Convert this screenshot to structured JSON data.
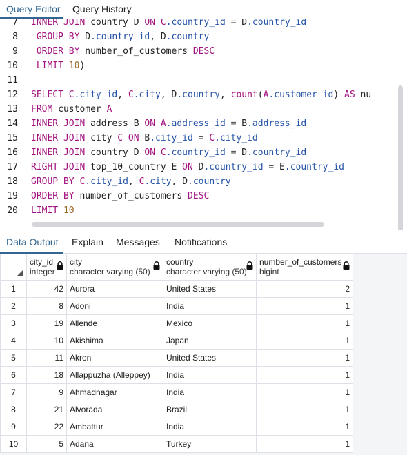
{
  "top_tabs": [
    {
      "label": "Query Editor",
      "active": true
    },
    {
      "label": "Query History",
      "active": false
    }
  ],
  "editor": {
    "line_numbers": [
      "7",
      "8",
      "9",
      "10",
      "11",
      "12",
      "13",
      "14",
      "15",
      "16",
      "17",
      "18",
      "19",
      "20"
    ],
    "lines": [
      [
        {
          "t": "INNER JOIN ",
          "c": "kw"
        },
        {
          "t": "country ",
          "c": "plain"
        },
        {
          "t": "D ",
          "c": "plain"
        },
        {
          "t": "ON ",
          "c": "kw"
        },
        {
          "t": "C",
          "c": "alias"
        },
        {
          "t": ".country_id",
          "c": "col"
        },
        {
          "t": " = ",
          "c": "op"
        },
        {
          "t": "D",
          "c": "plain"
        },
        {
          "t": ".country_id",
          "c": "col"
        }
      ],
      [
        {
          "t": " GROUP BY ",
          "c": "kw"
        },
        {
          "t": "D",
          "c": "plain"
        },
        {
          "t": ".country_id",
          "c": "col"
        },
        {
          "t": ", ",
          "c": "plain"
        },
        {
          "t": "D",
          "c": "plain"
        },
        {
          "t": ".country",
          "c": "col"
        }
      ],
      [
        {
          "t": " ORDER BY ",
          "c": "kw"
        },
        {
          "t": "number_of_customers ",
          "c": "plain"
        },
        {
          "t": "DESC",
          "c": "kw"
        }
      ],
      [
        {
          "t": " LIMIT ",
          "c": "kw"
        },
        {
          "t": "10",
          "c": "num"
        },
        {
          "t": ")",
          "c": "plain"
        }
      ],
      [],
      [
        {
          "t": "SELECT ",
          "c": "kw"
        },
        {
          "t": "C",
          "c": "alias"
        },
        {
          "t": ".city_id",
          "c": "col"
        },
        {
          "t": ", ",
          "c": "plain"
        },
        {
          "t": "C",
          "c": "alias"
        },
        {
          "t": ".city",
          "c": "col"
        },
        {
          "t": ", ",
          "c": "plain"
        },
        {
          "t": "D",
          "c": "plain"
        },
        {
          "t": ".country",
          "c": "col"
        },
        {
          "t": ", ",
          "c": "plain"
        },
        {
          "t": "count",
          "c": "fn"
        },
        {
          "t": "(",
          "c": "plain"
        },
        {
          "t": "A",
          "c": "alias"
        },
        {
          "t": ".customer_id",
          "c": "col"
        },
        {
          "t": ") ",
          "c": "plain"
        },
        {
          "t": "AS ",
          "c": "kw"
        },
        {
          "t": "nu",
          "c": "plain"
        }
      ],
      [
        {
          "t": "FROM ",
          "c": "kw"
        },
        {
          "t": "customer ",
          "c": "plain"
        },
        {
          "t": "A",
          "c": "alias"
        }
      ],
      [
        {
          "t": "INNER JOIN ",
          "c": "kw"
        },
        {
          "t": "address ",
          "c": "plain"
        },
        {
          "t": "B ",
          "c": "plain"
        },
        {
          "t": "ON ",
          "c": "kw"
        },
        {
          "t": "A",
          "c": "alias"
        },
        {
          "t": ".address_id",
          "c": "col"
        },
        {
          "t": " = ",
          "c": "op"
        },
        {
          "t": "B",
          "c": "plain"
        },
        {
          "t": ".address_id",
          "c": "col"
        }
      ],
      [
        {
          "t": "INNER JOIN ",
          "c": "kw"
        },
        {
          "t": "city ",
          "c": "plain"
        },
        {
          "t": "C ",
          "c": "alias"
        },
        {
          "t": "ON ",
          "c": "kw"
        },
        {
          "t": "B",
          "c": "plain"
        },
        {
          "t": ".city_id",
          "c": "col"
        },
        {
          "t": " = ",
          "c": "op"
        },
        {
          "t": "C",
          "c": "alias"
        },
        {
          "t": ".city_id",
          "c": "col"
        }
      ],
      [
        {
          "t": "INNER JOIN ",
          "c": "kw"
        },
        {
          "t": "country ",
          "c": "plain"
        },
        {
          "t": "D ",
          "c": "plain"
        },
        {
          "t": "ON ",
          "c": "kw"
        },
        {
          "t": "C",
          "c": "alias"
        },
        {
          "t": ".country_id",
          "c": "col"
        },
        {
          "t": " = ",
          "c": "op"
        },
        {
          "t": "D",
          "c": "plain"
        },
        {
          "t": ".country_id",
          "c": "col"
        }
      ],
      [
        {
          "t": "RIGHT JOIN ",
          "c": "kw"
        },
        {
          "t": "top_10_country ",
          "c": "plain"
        },
        {
          "t": "E ",
          "c": "plain"
        },
        {
          "t": "ON ",
          "c": "kw"
        },
        {
          "t": "D",
          "c": "plain"
        },
        {
          "t": ".country_id",
          "c": "col"
        },
        {
          "t": " = ",
          "c": "op"
        },
        {
          "t": "E",
          "c": "plain"
        },
        {
          "t": ".country_id",
          "c": "col"
        }
      ],
      [
        {
          "t": "GROUP BY ",
          "c": "kw"
        },
        {
          "t": "C",
          "c": "alias"
        },
        {
          "t": ".city_id",
          "c": "col"
        },
        {
          "t": ", ",
          "c": "plain"
        },
        {
          "t": "C",
          "c": "alias"
        },
        {
          "t": ".city",
          "c": "col"
        },
        {
          "t": ", ",
          "c": "plain"
        },
        {
          "t": "D",
          "c": "plain"
        },
        {
          "t": ".country",
          "c": "col"
        }
      ],
      [
        {
          "t": "ORDER BY ",
          "c": "kw"
        },
        {
          "t": "number_of_customers ",
          "c": "plain"
        },
        {
          "t": "DESC",
          "c": "kw"
        }
      ],
      [
        {
          "t": "LIMIT ",
          "c": "kw"
        },
        {
          "t": "10",
          "c": "num"
        }
      ]
    ]
  },
  "panel_tabs": [
    {
      "label": "Data Output",
      "active": true
    },
    {
      "label": "Explain",
      "active": false
    },
    {
      "label": "Messages",
      "active": false
    },
    {
      "label": "Notifications",
      "active": false
    }
  ],
  "grid": {
    "columns": [
      {
        "name": "city_id",
        "type": "integer"
      },
      {
        "name": "city",
        "type": "character varying (50)"
      },
      {
        "name": "country",
        "type": "character varying (50)"
      },
      {
        "name": "number_of_customers",
        "type": "bigint"
      }
    ],
    "rows": [
      {
        "n": "1",
        "city_id": "42",
        "city": "Aurora",
        "country": "United States",
        "count": "2"
      },
      {
        "n": "2",
        "city_id": "8",
        "city": "Adoni",
        "country": "India",
        "count": "1"
      },
      {
        "n": "3",
        "city_id": "19",
        "city": "Allende",
        "country": "Mexico",
        "count": "1"
      },
      {
        "n": "4",
        "city_id": "10",
        "city": "Akishima",
        "country": "Japan",
        "count": "1"
      },
      {
        "n": "5",
        "city_id": "11",
        "city": "Akron",
        "country": "United States",
        "count": "1"
      },
      {
        "n": "6",
        "city_id": "18",
        "city": "Allappuzha (Alleppey)",
        "country": "India",
        "count": "1"
      },
      {
        "n": "7",
        "city_id": "9",
        "city": "Ahmadnagar",
        "country": "India",
        "count": "1"
      },
      {
        "n": "8",
        "city_id": "21",
        "city": "Alvorada",
        "country": "Brazil",
        "count": "1"
      },
      {
        "n": "9",
        "city_id": "22",
        "city": "Ambattur",
        "country": "India",
        "count": "1"
      },
      {
        "n": "10",
        "city_id": "5",
        "city": "Adana",
        "country": "Turkey",
        "count": "1"
      }
    ]
  }
}
